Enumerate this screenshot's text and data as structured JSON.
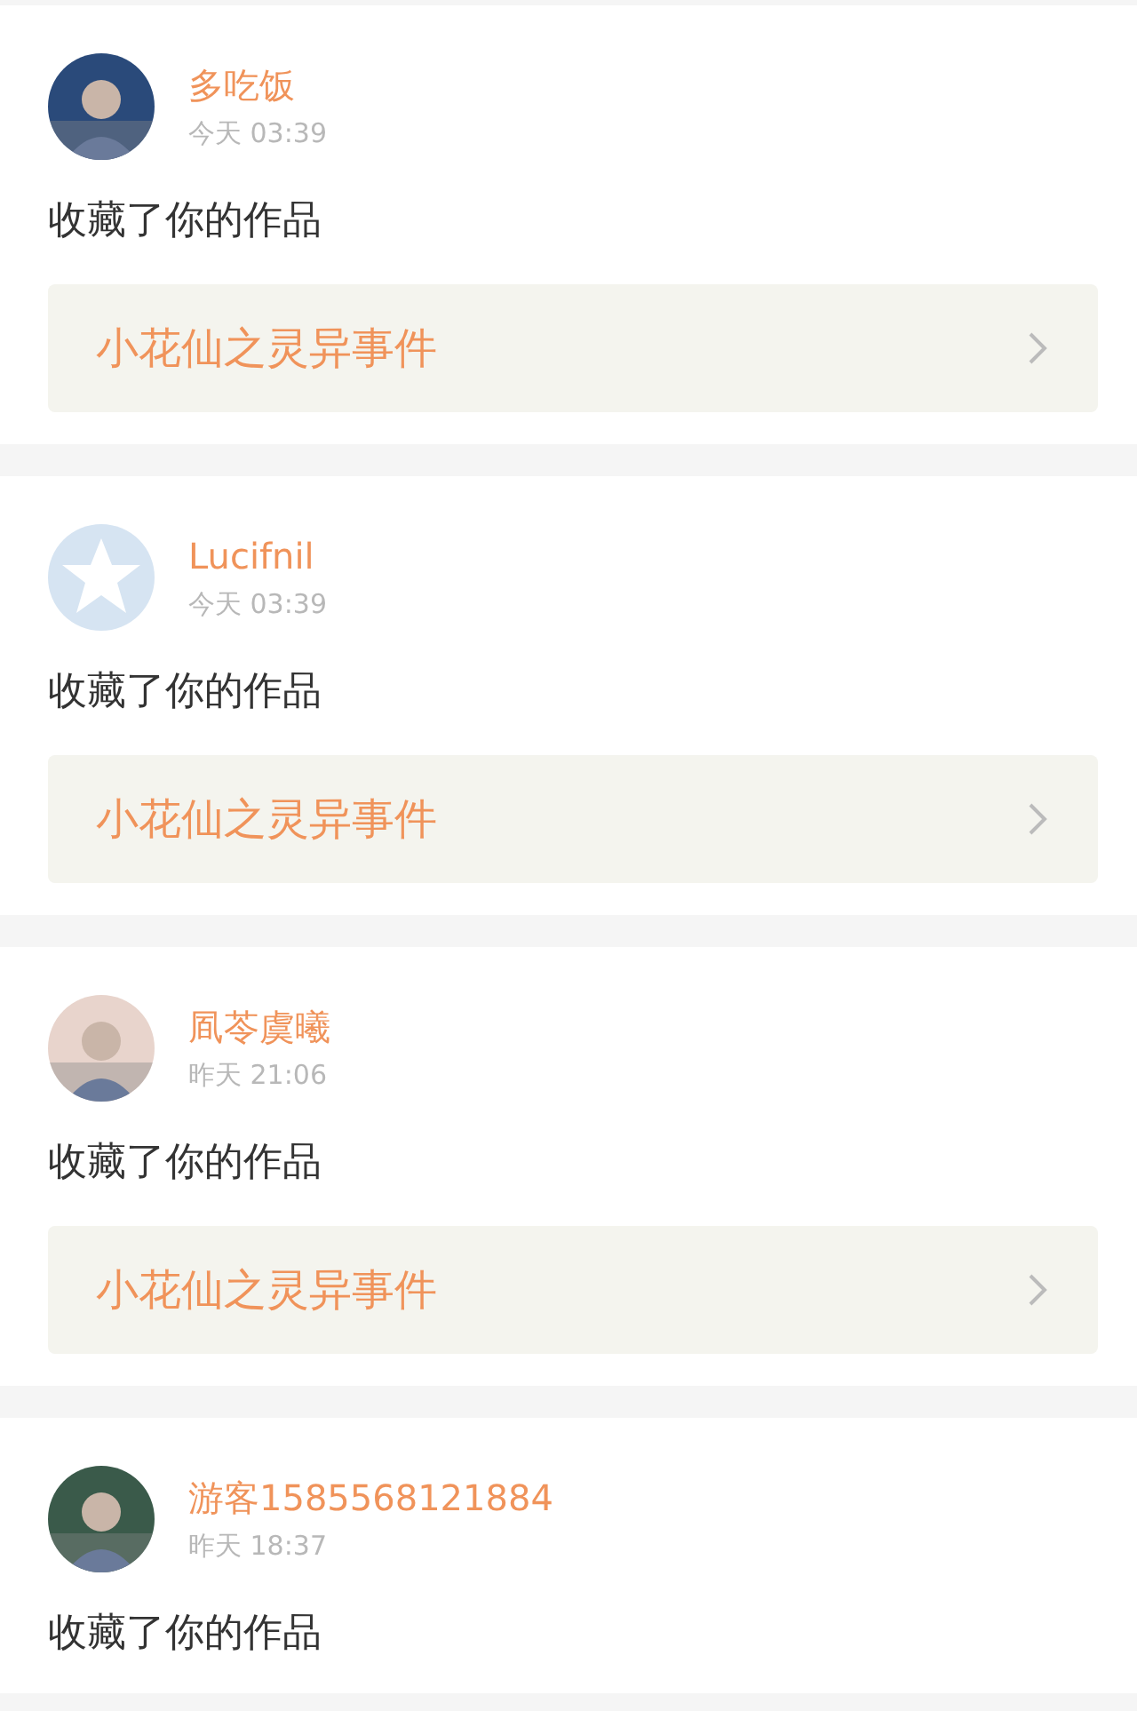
{
  "notifications": [
    {
      "user": "多吃饭",
      "time": "今天 03:39",
      "action": "收藏了你的作品",
      "work": "小花仙之灵异事件"
    },
    {
      "user": "Lucifnil",
      "avatar": {
        "kind": "default"
      },
      "time": "今天 03:39",
      "action": "收藏了你的作品",
      "work": "小花仙之灵异事件"
    },
    {
      "user": "凮苓虞曦",
      "time": "昨天 21:06",
      "action": "收藏了你的作品",
      "work": "小花仙之灵异事件"
    },
    {
      "user": "游客1585568121884",
      "time": "昨天 18:37",
      "action": "收藏了你的作品"
    }
  ]
}
